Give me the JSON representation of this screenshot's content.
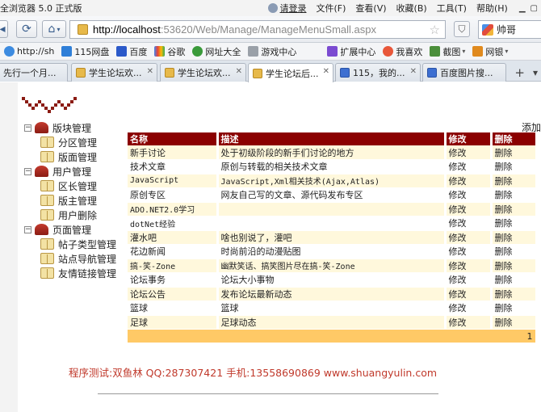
{
  "browser": {
    "title": "全浏览器 5.0 正式版",
    "login": "请登录",
    "menus": [
      "文件(F)",
      "查看(V)",
      "收藏(B)",
      "工具(T)",
      "帮助(H)"
    ],
    "url_host": "http://localhost",
    "url_path": ":53620/Web/Manage/ManageMenuSmall.aspx",
    "user_name": "帅哥",
    "favorites": [
      {
        "label": "http://sh",
        "icon": "ie-icon",
        "color": "#3d8be0"
      },
      {
        "label": "115网盘",
        "icon": "cloud-icon",
        "color": "#2f7fd8"
      },
      {
        "label": "百度",
        "icon": "baidu-icon",
        "color": "#2b59c9"
      },
      {
        "label": "谷歌",
        "icon": "google-icon",
        "color": "#e44"
      },
      {
        "label": "网址大全",
        "icon": "nav-icon",
        "color": "#3a9a3a"
      },
      {
        "label": "游戏中心",
        "icon": "game-icon",
        "color": "#888"
      },
      {
        "label": "扩展中心",
        "icon": "extension-icon",
        "color": "#7b4bd1"
      },
      {
        "label": "我喜欢",
        "icon": "heart-icon",
        "color": "#e8573a"
      },
      {
        "label": "截图",
        "icon": "screenshot-icon",
        "color": "#4b8f3b"
      },
      {
        "label": "网银",
        "icon": "bank-icon",
        "color": "#e08a1e"
      }
    ],
    "tabs": [
      {
        "label": "先行一个月..."
      },
      {
        "label": "学生论坛欢..."
      },
      {
        "label": "学生论坛欢..."
      },
      {
        "label": "学生论坛后..."
      },
      {
        "label": "115，我的..."
      },
      {
        "label": "百度图片搜..."
      }
    ]
  },
  "tree": {
    "groups": [
      {
        "label": "版块管理",
        "children": [
          "分区管理",
          "版面管理"
        ]
      },
      {
        "label": "用户管理",
        "children": [
          "区长管理",
          "版主管理",
          "用户删除"
        ]
      },
      {
        "label": "页面管理",
        "children": [
          "帖子类型管理",
          "站点导航管理",
          "友情链接管理"
        ]
      }
    ]
  },
  "table": {
    "add_label": "添加",
    "headers": {
      "name": "名称",
      "desc": "描述",
      "edit": "修改",
      "delete": "删除"
    },
    "rows": [
      {
        "name": "新手讨论",
        "desc": "处于初级阶段的新手们讨论的地方",
        "edit": "修改",
        "delete": "删除"
      },
      {
        "name": "技术文章",
        "desc": "原创与转载的相关技术文章",
        "edit": "修改",
        "delete": "删除"
      },
      {
        "name": "JavaScript",
        "desc": "JavaScript,Xml相关技术(Ajax,Atlas)",
        "edit": "修改",
        "delete": "删除"
      },
      {
        "name": "原创专区",
        "desc": "网友自己写的文章、源代码发布专区",
        "edit": "修改",
        "delete": "删除"
      },
      {
        "name": "ADO.NET2.0学习",
        "desc": "",
        "edit": "修改",
        "delete": "删除"
      },
      {
        "name": "dotNet经验",
        "desc": "",
        "edit": "修改",
        "delete": "删除"
      },
      {
        "name": "灌水吧",
        "desc": "啥也别说了，灌吧",
        "edit": "修改",
        "delete": "删除"
      },
      {
        "name": "花边新闻",
        "desc": "时尚前沿的动漫贴图",
        "edit": "修改",
        "delete": "删除"
      },
      {
        "name": "搞-笑-Zone",
        "desc": "幽默笑话、搞笑图片尽在搞-笑-Zone",
        "edit": "修改",
        "delete": "删除"
      },
      {
        "name": "论坛事务",
        "desc": "论坛大小事物",
        "edit": "修改",
        "delete": "删除"
      },
      {
        "name": "论坛公告",
        "desc": "发布论坛最新动态",
        "edit": "修改",
        "delete": "删除"
      },
      {
        "name": "篮球",
        "desc": "篮球",
        "edit": "修改",
        "delete": "删除"
      },
      {
        "name": "足球",
        "desc": "足球动态",
        "edit": "修改",
        "delete": "删除"
      }
    ],
    "page_number": "1"
  },
  "footer": "程序测试:双鱼林 QQ:287307421 手机:13558690869 www.shuangyulin.com",
  "colors": {
    "header_bg": "#8b0000",
    "row_alt": "#fff8dc",
    "pager_bg": "#ffc966",
    "footer_text": "#c0392b"
  }
}
